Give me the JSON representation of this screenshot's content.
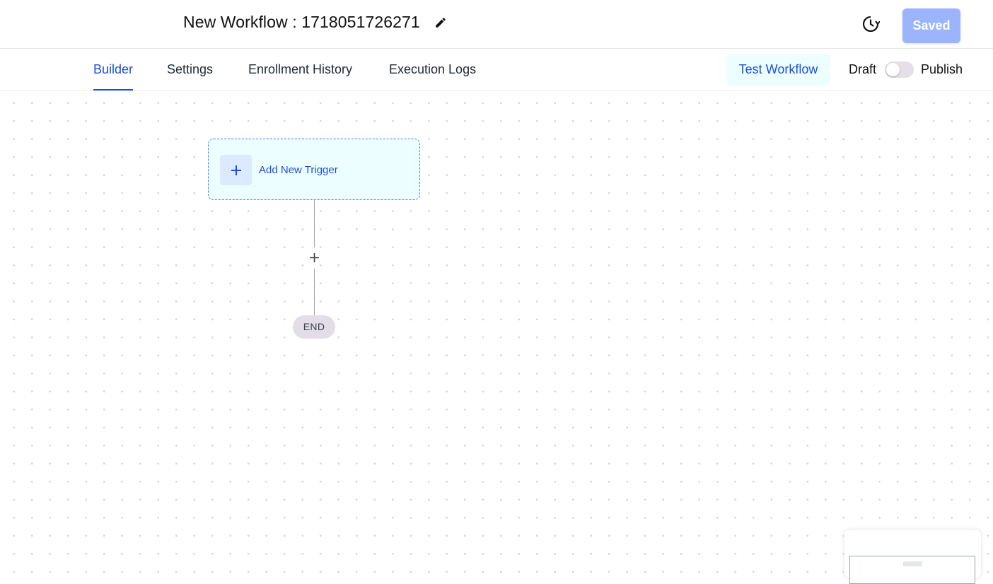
{
  "header": {
    "workflow_title": "New Workflow : 1718051726271",
    "saved_label": "Saved",
    "icons": {
      "edit": "pencil-icon",
      "history": "history-icon"
    }
  },
  "tabs": [
    {
      "label": "Builder",
      "active": true
    },
    {
      "label": "Settings",
      "active": false
    },
    {
      "label": "Enrollment History",
      "active": false
    },
    {
      "label": "Execution Logs",
      "active": false
    }
  ],
  "actions": {
    "test_label": "Test Workflow",
    "draft_label": "Draft",
    "publish_label": "Publish",
    "publish_toggle_on": false
  },
  "canvas": {
    "trigger_label": "Add New Trigger",
    "end_label": "END",
    "icons": {
      "trigger": "plus-icon",
      "add_step": "plus-icon"
    }
  },
  "colors": {
    "accent": "#1d4fd8",
    "saved_button": "#9bb4fb",
    "trigger_bg": "#ecfeff",
    "end_node": "#e3dde7"
  }
}
